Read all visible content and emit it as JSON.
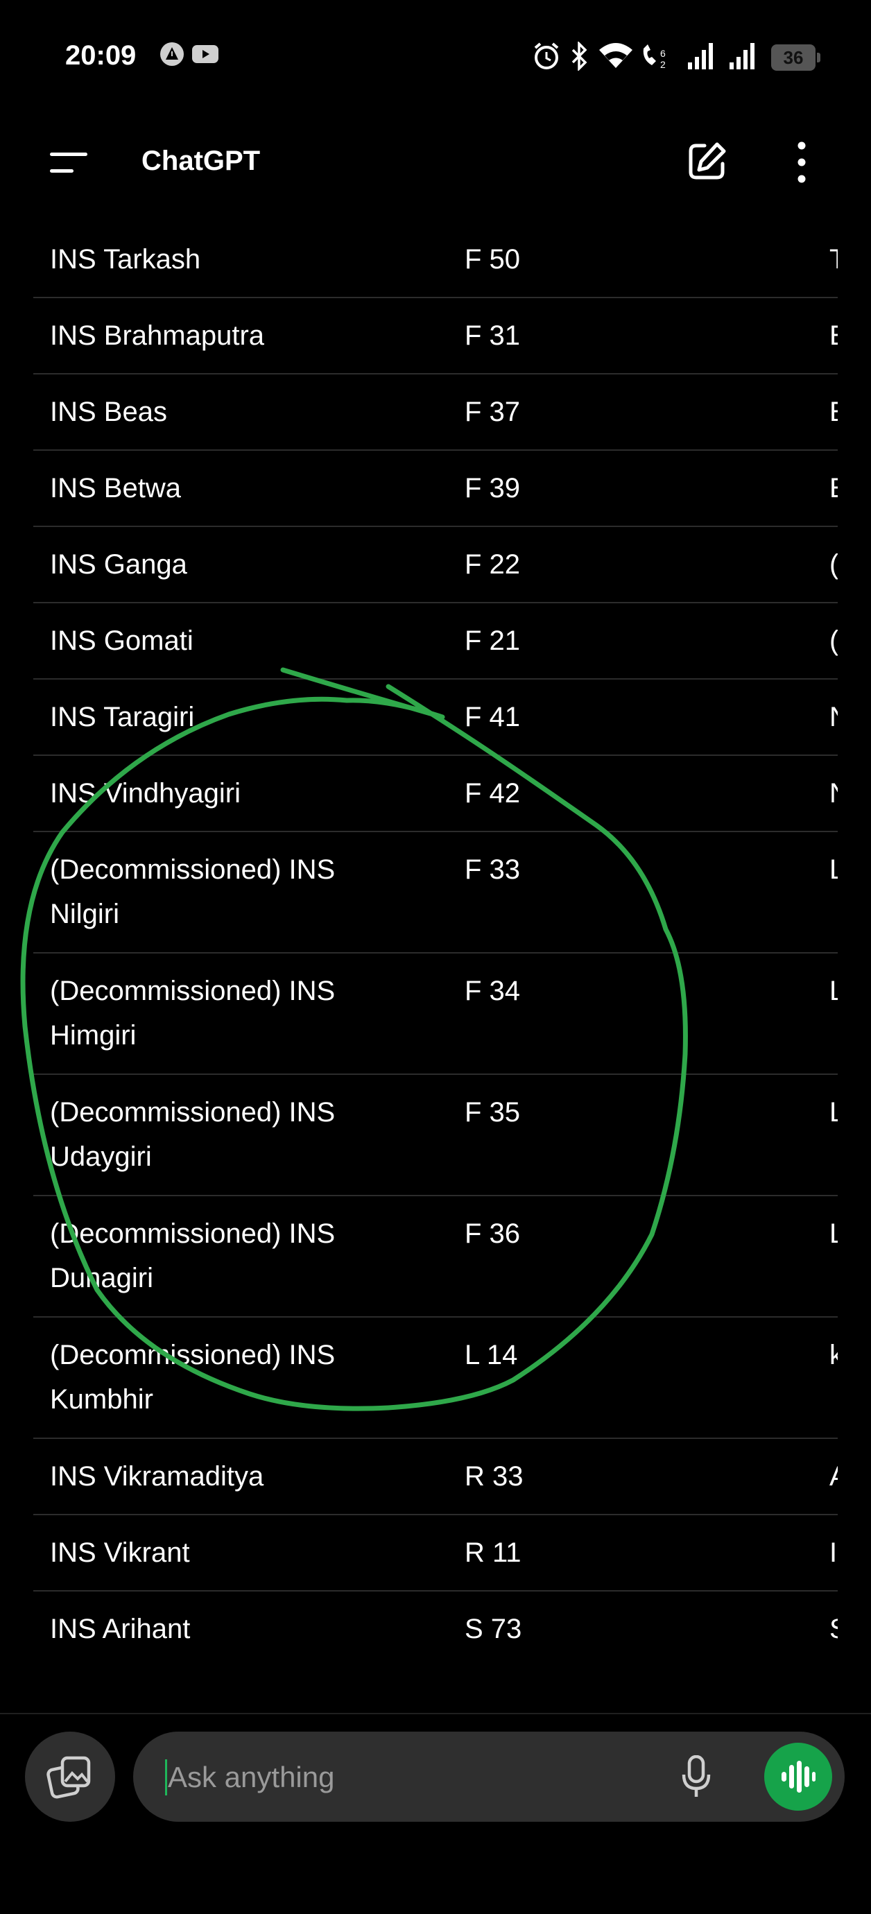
{
  "status_bar": {
    "time": "20:09",
    "battery": "36",
    "icons": [
      "notification-warning-icon",
      "youtube-icon",
      "alarm-icon",
      "bluetooth-icon",
      "wifi-icon",
      "volte-icon",
      "signal-icon",
      "signal-icon-2",
      "battery-icon"
    ]
  },
  "header": {
    "title": "ChatGPT",
    "icons": [
      "menu-icon",
      "new-chat-icon",
      "more-icon"
    ]
  },
  "table": {
    "rows": [
      {
        "name": "INS Tarkash",
        "pennant": "F 50",
        "partial": "T"
      },
      {
        "name": "INS Brahmaputra",
        "pennant": "F 31",
        "partial": "E"
      },
      {
        "name": "INS Beas",
        "pennant": "F 37",
        "partial": "E"
      },
      {
        "name": "INS Betwa",
        "pennant": "F 39",
        "partial": "E"
      },
      {
        "name": "INS Ganga",
        "pennant": "F 22",
        "partial": "("
      },
      {
        "name": "INS Gomati",
        "pennant": "F 21",
        "partial": "("
      },
      {
        "name": "INS Taragiri",
        "pennant": "F 41",
        "partial": "N"
      },
      {
        "name": "INS Vindhyagiri",
        "pennant": "F 42",
        "partial": "N"
      },
      {
        "name": "(Decommissioned) INS Nilgiri",
        "pennant": "F 33",
        "partial": "L"
      },
      {
        "name": "(Decommissioned) INS Himgiri",
        "pennant": "F 34",
        "partial": "L"
      },
      {
        "name": "(Decommissioned) INS Udaygiri",
        "pennant": "F 35",
        "partial": "L"
      },
      {
        "name": "(Decommissioned) INS Dunagiri",
        "pennant": "F 36",
        "partial": "L"
      },
      {
        "name": "(Decommissioned) INS Kumbhir",
        "pennant": "L 14",
        "partial": "k s"
      },
      {
        "name": "INS Vikramaditya",
        "pennant": "R 33",
        "partial": "A"
      },
      {
        "name": "INS Vikrant",
        "pennant": "R 11",
        "partial": "I"
      },
      {
        "name": "INS Arihant",
        "pennant": "S 73",
        "partial": "S r"
      }
    ]
  },
  "composer": {
    "placeholder": "Ask anything",
    "icons": [
      "attach-image-icon",
      "microphone-icon",
      "voice-mode-icon"
    ]
  },
  "colors": {
    "background": "#000000",
    "accent": "#16a34a",
    "annotation": "#2fa84a",
    "input_bg": "#2f2f2f",
    "divider": "#2c2c2c"
  }
}
